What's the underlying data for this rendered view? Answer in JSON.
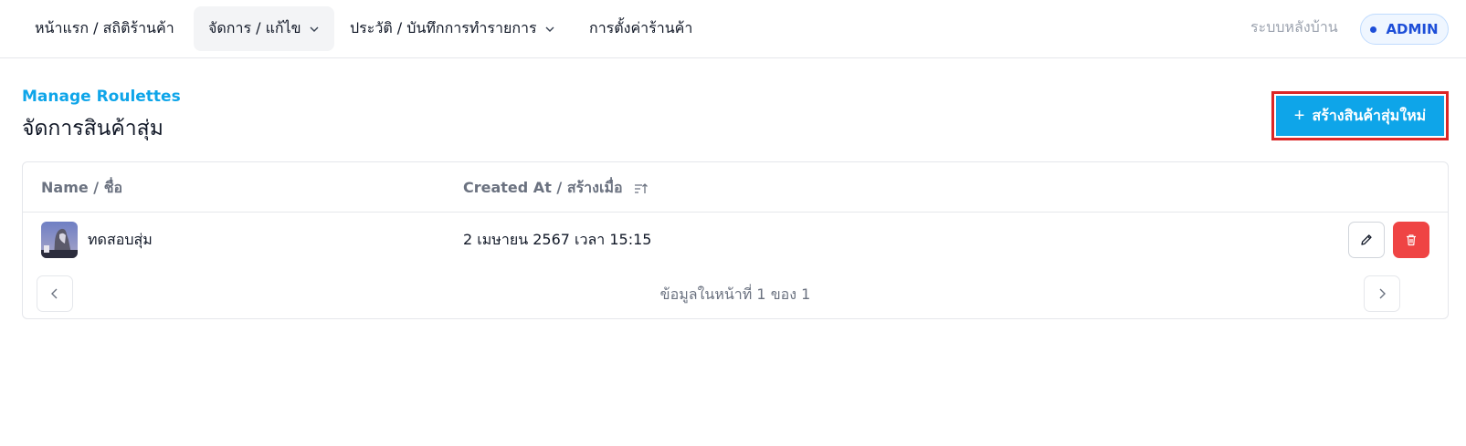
{
  "nav": {
    "items": [
      {
        "label": "หน้าแรก / สถิติร้านค้า",
        "has_dropdown": false,
        "active": false
      },
      {
        "label": "จัดการ / แก้ไข",
        "has_dropdown": true,
        "active": true
      },
      {
        "label": "ประวัติ / บันทึกการทำรายการ",
        "has_dropdown": true,
        "active": false
      },
      {
        "label": "การตั้งค่าร้านค้า",
        "has_dropdown": false,
        "active": false
      }
    ],
    "backoffice_label": "ระบบหลังบ้าน",
    "role_badge": "ADMIN"
  },
  "header": {
    "eyebrow": "Manage Roulettes",
    "title": "จัดการสินค้าสุ่ม",
    "create_button_label": "สร้างสินค้าสุ่มใหม่"
  },
  "table": {
    "columns": [
      "Name / ชื่อ",
      "Created At / สร้างเมื่อ"
    ],
    "rows": [
      {
        "name": "ทดสอบสุ่ม",
        "created_at": "2 เมษายน 2567 เวลา 15:15",
        "thumbnail": "roulette-thumbnail"
      }
    ],
    "pagination_text": "ข้อมูลในหน้าที่ 1 ของ 1"
  },
  "icons": {
    "chevron": "chevron-down-icon",
    "sort": "sort-ascending-icon",
    "edit": "pencil-icon",
    "delete": "trash-icon",
    "prev": "chevron-left-icon",
    "next": "chevron-right-icon",
    "plus": "plus-icon"
  },
  "colors": {
    "accent": "#0ea5e9",
    "danger": "#ef4444",
    "highlight_border": "#dc2626",
    "badge_text": "#1d4ed8"
  }
}
